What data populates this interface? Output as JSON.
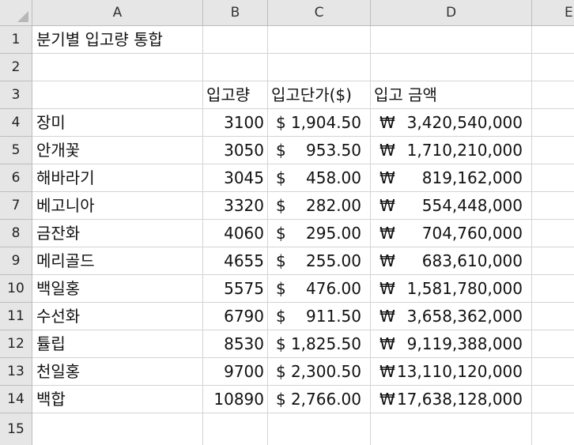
{
  "columns": [
    "A",
    "B",
    "C",
    "D",
    "E"
  ],
  "rows": [
    "1",
    "2",
    "3",
    "4",
    "5",
    "6",
    "7",
    "8",
    "9",
    "10",
    "11",
    "12",
    "13",
    "14",
    "15"
  ],
  "title": "분기별 입고량 통합",
  "headers": {
    "qty": "입고량",
    "unit_price": "입고단가($)",
    "amount": "입고 금액"
  },
  "currency": {
    "usd": "$",
    "krw": "₩"
  },
  "items": [
    {
      "name": "장미",
      "qty": "3100",
      "price": "1,904.50",
      "amount": "3,420,540,000"
    },
    {
      "name": "안개꽃",
      "qty": "3050",
      "price": "953.50",
      "amount": "1,710,210,000"
    },
    {
      "name": "해바라기",
      "qty": "3045",
      "price": "458.00",
      "amount": "819,162,000"
    },
    {
      "name": "베고니아",
      "qty": "3320",
      "price": "282.00",
      "amount": "554,448,000"
    },
    {
      "name": "금잔화",
      "qty": "4060",
      "price": "295.00",
      "amount": "704,760,000"
    },
    {
      "name": "메리골드",
      "qty": "4655",
      "price": "255.00",
      "amount": "683,610,000"
    },
    {
      "name": "백일홍",
      "qty": "5575",
      "price": "476.00",
      "amount": "1,581,780,000"
    },
    {
      "name": "수선화",
      "qty": "6790",
      "price": "911.50",
      "amount": "3,658,362,000"
    },
    {
      "name": "튤립",
      "qty": "8530",
      "price": "1,825.50",
      "amount": "9,119,388,000"
    },
    {
      "name": "천일홍",
      "qty": "9700",
      "price": "2,300.50",
      "amount": "13,110,120,000"
    },
    {
      "name": "백합",
      "qty": "10890",
      "price": "2,766.00",
      "amount": "17,638,128,000"
    }
  ]
}
